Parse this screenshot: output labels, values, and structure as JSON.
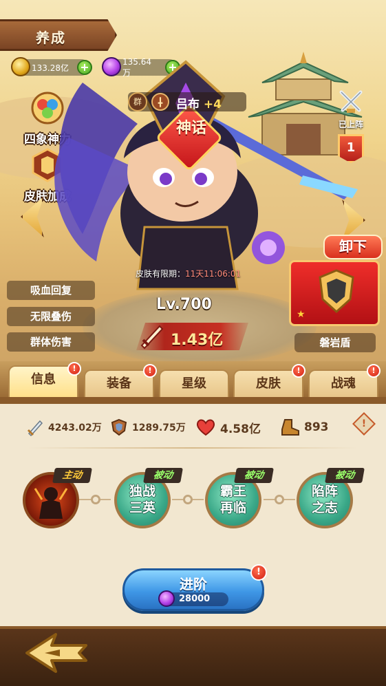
{
  "header": {
    "title": "养成"
  },
  "resources": [
    {
      "icon": "gold-coin-icon",
      "value": "133.28亿"
    },
    {
      "icon": "purple-gem-icon",
      "value": "135.64万"
    }
  ],
  "side_menu": [
    {
      "icon": "four-symbols-icon",
      "label": "四象神力"
    },
    {
      "icon": "skin-bonus-icon",
      "label": "皮肤加成"
    }
  ],
  "hero": {
    "faction": "群",
    "name": "吕布",
    "plus": "+4",
    "rarity": "神话",
    "level": "Lv.700",
    "power": "1.43亿",
    "skin_expiry_label": "皮肤有限期：",
    "skin_expiry_time": "11天11:06:01"
  },
  "deploy": {
    "label": "已上阵",
    "number": "1"
  },
  "skin": {
    "unequip_label": "卸下",
    "name": "磐岩盾"
  },
  "traits": [
    "吸血回复",
    "无限叠伤",
    "群体伤害"
  ],
  "tabs": [
    "信息",
    "装备",
    "星级",
    "皮肤",
    "战魂"
  ],
  "stats": {
    "attack": "4243.02万",
    "defense": "1289.75万",
    "hp": "4.58亿",
    "speed": "893"
  },
  "skills": [
    {
      "tag": "主动",
      "text": ""
    },
    {
      "tag": "被动",
      "text": "独战三英"
    },
    {
      "tag": "被动",
      "text": "霸王再临"
    },
    {
      "tag": "被动",
      "text": "陷阵之志"
    }
  ],
  "advance": {
    "label": "进阶",
    "cost": "28000"
  },
  "colors": {
    "accent": "#d9301e",
    "panel": "#f2e7d0",
    "passive_tag": "#9aff6a",
    "active_tag": "#ffcb3a"
  }
}
